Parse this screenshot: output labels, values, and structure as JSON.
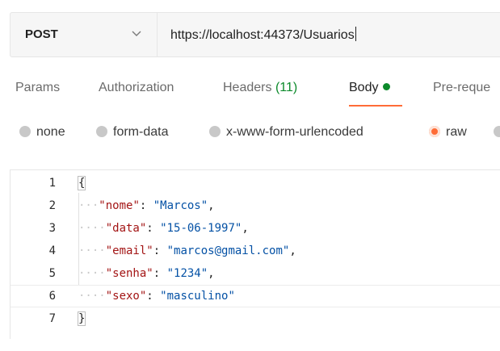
{
  "request": {
    "method": "POST",
    "url": "https://localhost:44373/Usuarios"
  },
  "tabs": [
    {
      "label": "Params"
    },
    {
      "label": "Authorization"
    },
    {
      "label": "Headers",
      "count": "(11)"
    },
    {
      "label": "Body"
    },
    {
      "label": "Pre-reque"
    }
  ],
  "body_types": [
    {
      "label": "none",
      "selected": false
    },
    {
      "label": "form-data",
      "selected": false
    },
    {
      "label": "x-www-form-urlencoded",
      "selected": false
    },
    {
      "label": "raw",
      "selected": true
    }
  ],
  "editor": {
    "lines": [
      {
        "num": "1",
        "text": "{"
      },
      {
        "num": "2",
        "indent": "···",
        "key": "\"nome\"",
        "value": "\"Marcos\"",
        "trail": ","
      },
      {
        "num": "3",
        "indent": "····",
        "key": "\"data\"",
        "value": "\"15-06-1997\"",
        "trail": ","
      },
      {
        "num": "4",
        "indent": "····",
        "key": "\"email\"",
        "value": "\"marcos@gmail.com\"",
        "trail": ","
      },
      {
        "num": "5",
        "indent": "····",
        "key": "\"senha\"",
        "value": "\"1234\"",
        "trail": ","
      },
      {
        "num": "6",
        "indent": "····",
        "key": "\"sexo\"",
        "value": "\"masculino\"",
        "trail": ""
      },
      {
        "num": "7",
        "text": "}"
      }
    ]
  },
  "colors": {
    "accent": "#ff6c37",
    "success": "#0c8a2b",
    "json_key": "#a31515",
    "json_string": "#0451a5"
  }
}
